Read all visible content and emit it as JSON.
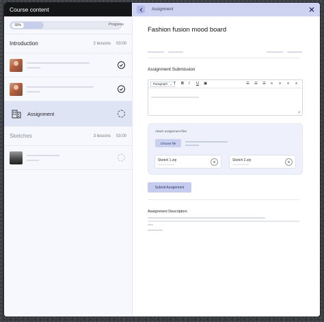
{
  "sidebar": {
    "header_title": "Course content",
    "progress": {
      "percent_label": "30%",
      "fraction": 0.3,
      "label": "Progress"
    },
    "sections": [
      {
        "title": "Introduction",
        "lessons_count": "2 lessons",
        "duration": "03:00"
      },
      {
        "title": "Sketches",
        "lessons_count": "3 lessons",
        "duration": "03:00"
      }
    ],
    "assignment_label": "Assignment"
  },
  "main": {
    "header_title": "Assignment",
    "page_title": "Fashion fusion mood board",
    "submission_title": "Assignment Submission",
    "editor": {
      "format_select": "Paragraph",
      "toolbar_icons": [
        "text-size-icon",
        "bold-icon",
        "italic-icon",
        "underline-icon",
        "image-icon",
        "bullet-list-icon",
        "numbered-list-icon",
        "indent-icon",
        "align-left-icon",
        "align-center-icon",
        "align-right-icon",
        "align-justify-icon"
      ]
    },
    "upload": {
      "label": "Attach assignment files",
      "choose_button": "Choose file",
      "files": [
        {
          "name": "Sketch 1.zip"
        },
        {
          "name": "Sketch 2.zip"
        }
      ]
    },
    "submit_button": "Submit Assignment",
    "description_title": "Assignment Description"
  },
  "colors": {
    "sidebar_bg": "#f6f8fd",
    "active_bg": "#dfe4f5",
    "header_accent": "#cdd3f0",
    "button_accent": "#c5ccf0"
  }
}
